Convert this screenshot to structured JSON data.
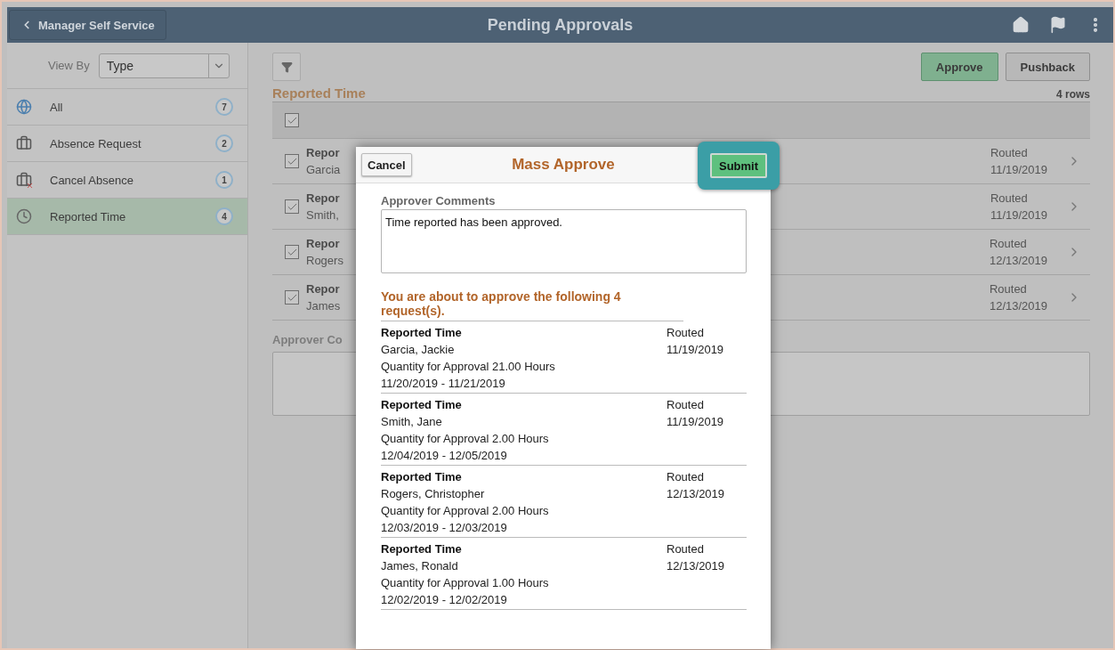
{
  "header": {
    "back_label": "Manager Self Service",
    "title": "Pending Approvals"
  },
  "sidebar": {
    "view_by": {
      "label": "View By",
      "value": "Type"
    },
    "items": [
      {
        "kind": "globe",
        "label": "All",
        "count": "7",
        "selected": false
      },
      {
        "kind": "briefcase",
        "label": "Absence Request",
        "count": "2",
        "selected": false
      },
      {
        "kind": "briefcase-cancel",
        "label": "Cancel Absence",
        "count": "1",
        "selected": false
      },
      {
        "kind": "clock",
        "label": "Reported Time",
        "count": "4",
        "selected": true
      }
    ]
  },
  "main": {
    "approve": "Approve",
    "pushback": "Pushback",
    "section_title": "Reported Time",
    "row_count": "4 rows",
    "select_all_checked": true,
    "rows": [
      {
        "checked": true,
        "title": "Repor",
        "name": "Garcia",
        "status": "Routed",
        "date": "11/19/2019"
      },
      {
        "checked": true,
        "title": "Repor",
        "name": "Smith,",
        "status": "Routed",
        "date": "11/19/2019"
      },
      {
        "checked": true,
        "title": "Repor",
        "name": "Rogers",
        "status": "Routed",
        "date": "12/13/2019"
      },
      {
        "checked": true,
        "title": "Repor",
        "name": "James",
        "status": "Routed",
        "date": "12/13/2019"
      }
    ],
    "comments_label": "Approver Co"
  },
  "modal": {
    "cancel": "Cancel",
    "title": "Mass Approve",
    "submit": "Submit",
    "comments_label": "Approver Comments",
    "comments_value": "Time reported has been approved.",
    "message": "You are about to approve the following 4 request(s).",
    "requests": [
      {
        "type": "Reported Time",
        "name": "Garcia, Jackie",
        "quantity": "Quantity for Approval 21.00 Hours",
        "dates": "11/20/2019 - 11/21/2019",
        "status": "Routed",
        "date": "11/19/2019"
      },
      {
        "type": "Reported Time",
        "name": "Smith, Jane",
        "quantity": "Quantity for Approval 2.00 Hours",
        "dates": "12/04/2019 - 12/05/2019",
        "status": "Routed",
        "date": "11/19/2019"
      },
      {
        "type": "Reported Time",
        "name": "Rogers, Christopher",
        "quantity": "Quantity for Approval 2.00 Hours",
        "dates": "12/03/2019 - 12/03/2019",
        "status": "Routed",
        "date": "12/13/2019"
      },
      {
        "type": "Reported Time",
        "name": "James, Ronald",
        "quantity": "Quantity for Approval 1.00 Hours",
        "dates": "12/02/2019 - 12/02/2019",
        "status": "Routed",
        "date": "12/13/2019"
      }
    ]
  }
}
